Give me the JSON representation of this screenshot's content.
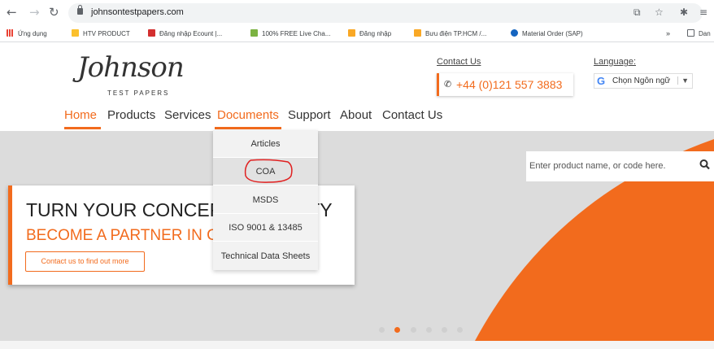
{
  "browser": {
    "url": "johnsontestpapers.com",
    "back_icon": "arrow-left-icon",
    "forward_icon": "arrow-right-icon",
    "reload_icon": "reload-icon",
    "bookmarks": [
      {
        "label": "Ứng dụng",
        "color": "#ea4335"
      },
      {
        "label": "HTV PRODUCT",
        "color": "#fbc02d"
      },
      {
        "label": "Đăng nhập Ecount |...",
        "color": "#d32f2f"
      },
      {
        "label": "100% FREE Live Cha...",
        "color": "#7cb342"
      },
      {
        "label": "Đăng nhập",
        "color": "#f9a825"
      },
      {
        "label": "Bưu điện TP.HCM /...",
        "color": "#f9a825"
      },
      {
        "label": "Material Order (SAP)",
        "color": "#1565c0"
      },
      {
        "label": "Dan",
        "color": "#5f6368"
      }
    ],
    "more_bookmarks": "»"
  },
  "site": {
    "logo_text": "Johnson",
    "logo_subtext": "TEST PAPERS",
    "contact_link": "Contact Us",
    "phone": "+44 (0)121 557 3883",
    "language_link": "Language:",
    "language_select": "Chọn Ngôn ngữ",
    "language_arrow": "▼",
    "menu": [
      "Home",
      "Products",
      "Services",
      "Documents",
      "Support",
      "About",
      "Contact Us"
    ],
    "dropdown": [
      "Articles",
      "COA",
      "MSDS",
      "ISO 9001 & 13485",
      "Technical Data Sheets"
    ],
    "search_placeholder": "Enter product name, or code here.",
    "promo_title": "TURN YOUR CONCEPT INTO REALITY",
    "promo_title_visible_left": "TURN YOUR CONCEPT",
    "promo_title_visible_right": "TY",
    "promo_subtitle": "BECOME A PARTNER IN C",
    "promo_button": "Contact us to find out more",
    "slide_count": 6,
    "active_slide": 2
  },
  "colors": {
    "accent": "#f26b1d",
    "hero_bg": "#dcdcdc",
    "annotation": "#e02020"
  }
}
